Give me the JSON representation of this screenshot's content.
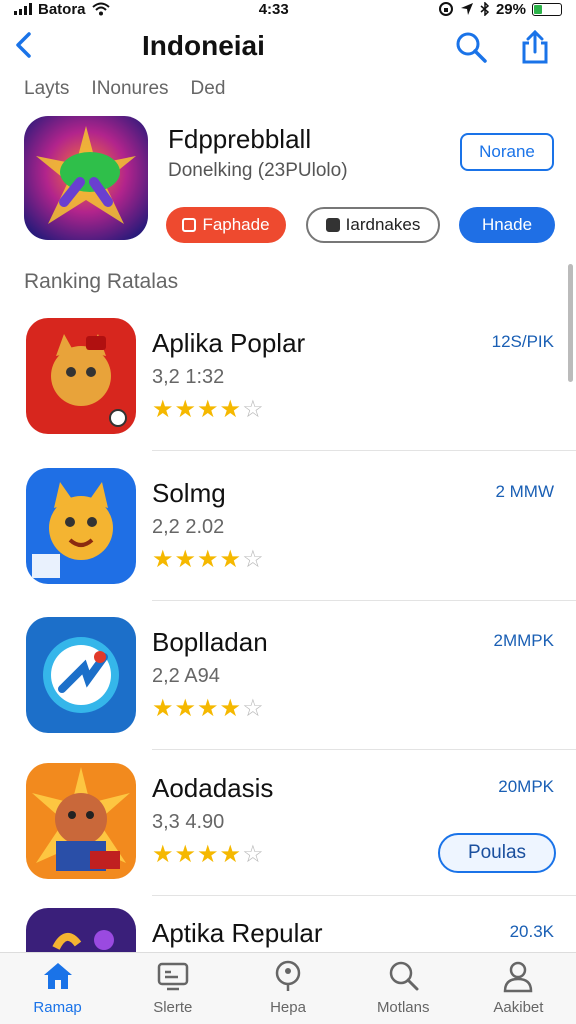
{
  "status_bar": {
    "carrier": "Batora",
    "time": "4:33",
    "battery": "29%"
  },
  "nav": {
    "back_label": "",
    "title": "Indoneiai"
  },
  "tabs": [
    "Layts",
    "INonures",
    "Ded"
  ],
  "featured": {
    "title": "Fdpprebblall",
    "subtitle": "Donelking (23PUlolo)",
    "top_button": "Norane",
    "actions": [
      "Faphade",
      "Iardnakes",
      "Hnade"
    ]
  },
  "section_title": "Ranking Ratalas",
  "apps": [
    {
      "name": "Aplika Poplar",
      "meta": "3,2 1:32",
      "count": "12S/PIK",
      "rating": 4
    },
    {
      "name": "Solmg",
      "meta": "2,2 2.02",
      "count": "2 MMW",
      "rating": 4
    },
    {
      "name": "Boplladan",
      "meta": "2,2 A94",
      "count": "2MMPK",
      "rating": 4
    },
    {
      "name": "Aodadasis",
      "meta": "3,3 4.90",
      "count": "20MPK",
      "rating": 4,
      "button": "Poulas"
    },
    {
      "name": "Aptika Repular",
      "meta": "",
      "count": "20.3K",
      "rating": 0
    }
  ],
  "bottom_tabs": [
    {
      "label": "Ramap",
      "icon": "home-icon",
      "active": true
    },
    {
      "label": "Slerte",
      "icon": "screen-icon",
      "active": false
    },
    {
      "label": "Hepa",
      "icon": "pin-icon",
      "active": false
    },
    {
      "label": "Motlans",
      "icon": "search-icon",
      "active": false
    },
    {
      "label": "Aakibet",
      "icon": "person-icon",
      "active": false
    }
  ],
  "colors": {
    "accent": "#1a73e8",
    "star": "#f5b800",
    "red": "#ee4a2f"
  }
}
